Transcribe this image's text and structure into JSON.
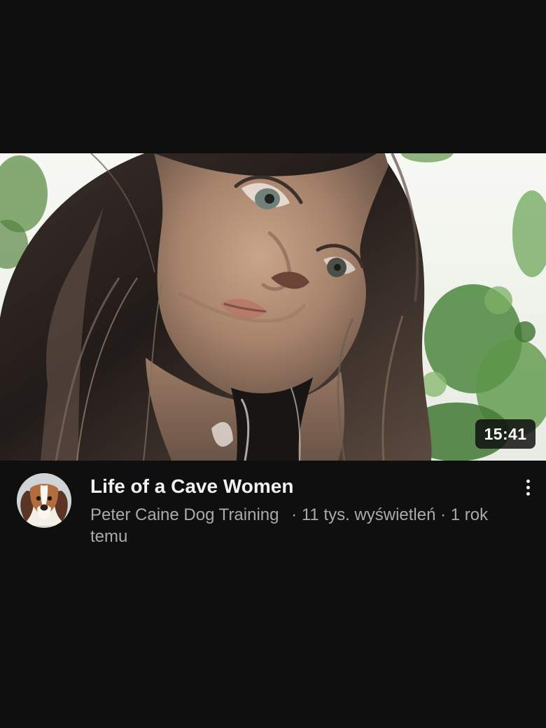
{
  "video": {
    "duration": "15:41",
    "title": "Life of a Cave Women",
    "channel": "Peter Caine Dog Training",
    "views": "· 11 tys. wyświetleń",
    "age": "· 1 rok temu"
  },
  "icons": {
    "avatar": "dog-avatar-icon",
    "more": "more-vert-icon"
  }
}
